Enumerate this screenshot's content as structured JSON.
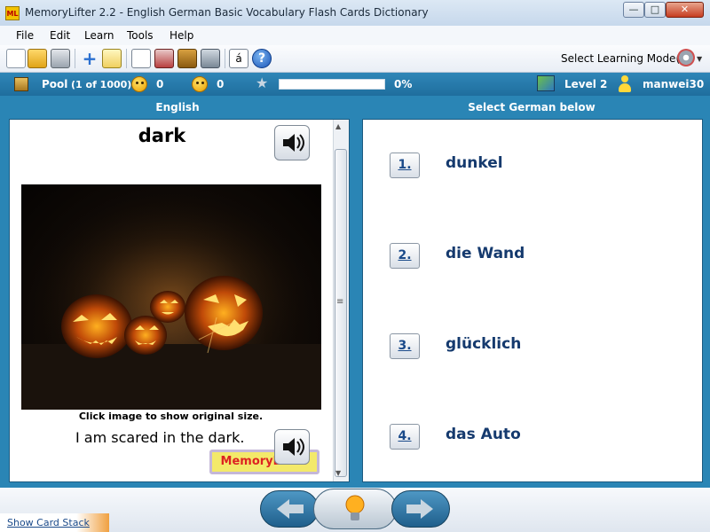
{
  "window": {
    "icon_text": "ML",
    "title": "MemoryLifter 2.2 - English German Basic Vocabulary Flash Cards Dictionary",
    "minimize_label": "—",
    "maximize_label": "□",
    "close_label": "✕"
  },
  "menu": {
    "items": [
      "File",
      "Edit",
      "Learn",
      "Tools",
      "Help"
    ]
  },
  "toolbar": {
    "icons": [
      "new-icon",
      "open-icon",
      "print-icon",
      "add-icon",
      "edit-icon",
      "presentation-icon",
      "card-icon",
      "dictionary-icon",
      "tools-icon",
      "character-icon",
      "help-icon"
    ],
    "char_label": "á",
    "help_label": "?",
    "mode_label": "Select Learning Mode(s)"
  },
  "status": {
    "pool_label": "Pool",
    "pool_count": "(1 of 1000)",
    "smiley_right_count": "0",
    "smiley_wrong_count": "0",
    "progress_percent": "0%",
    "progress_value": 0,
    "level": "Level 2",
    "user": "manwei30"
  },
  "columns": {
    "left_header": "English",
    "right_header": "Select German below"
  },
  "card": {
    "word": "dark",
    "image_caption": "Click image to show original size.",
    "sentence": "I am scared in the dark.",
    "logo_text": "MemoryLifter"
  },
  "answers": [
    {
      "number": "1.",
      "text": "dunkel"
    },
    {
      "number": "2.",
      "text": "die Wand"
    },
    {
      "number": "3.",
      "text": "glücklich"
    },
    {
      "number": "4.",
      "text": "das Auto"
    }
  ],
  "footer": {
    "card_stack_link": "Show Card Stack"
  },
  "colors": {
    "accent": "#2a85b5",
    "answer_text": "#153a6e",
    "progress": "#3c9ad0"
  }
}
